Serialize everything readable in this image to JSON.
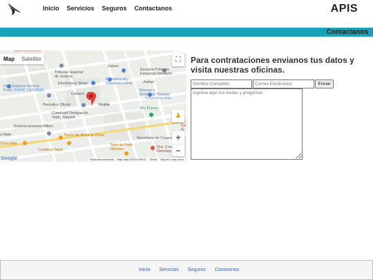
{
  "nav": {
    "links": [
      "Inicio",
      "Servicios",
      "Seguros",
      "Contactanos"
    ],
    "brand": "APIS"
  },
  "banner": {
    "title": "Contactanos"
  },
  "map": {
    "tabs": [
      "Map",
      "Satellite"
    ],
    "google": "Google",
    "footer": [
      "Keyboard shortcuts",
      "Map data ©2023 INEGI",
      "Terms",
      "Report a map error"
    ],
    "labels": {
      "tribunal": "Tribunal Superior\nde Justicia",
      "escuela": "Escuela Primaria\nFernando Montaño",
      "papeleria": "Papelería Ary\nStationery store",
      "juarez1": "Juárez",
      "juarez2": "Juárez",
      "dhl": "DHL Express Service\nPoint (TEPIC CENTRO)",
      "electronica": "Electronica Show",
      "canaco": "Canaco",
      "marcos": "Marcos y\nMolduras \"Batista\"",
      "picture": "Picture frame shop",
      "metlife": "Metlife",
      "periodico": "Periodico Oficial",
      "condusef": "Condusef Delegación\nTepic, Nayarit",
      "rivplanet": "Riv Planet",
      "estacionamiento": "Estacionamiento Milton",
      "nata": "a Nata",
      "tacos": "Tacos de Birria la China",
      "secretaria": "Secretaria de Finanzas",
      "chocolate": "Chocolate",
      "condesa": "Condesa Tepic",
      "todopollo": "Todo de Pollo\nChicken",
      "dra": "Dra. Con\nOdontop",
      "ce": "Ce\nN"
    }
  },
  "form": {
    "title": "Para contrataciones envianos tus datos y visita nuestras oficinas.",
    "name_placeholder": "Nombre Completo",
    "email_placeholder": "Correo Electronico",
    "submit": "Enviar",
    "message_placeholder": "Ingresa aqui tus dudas y preguntas"
  },
  "footer": {
    "links": [
      "Inicio",
      "Servicios",
      "Seguros",
      "Conocenos"
    ]
  },
  "colors": {
    "teal": "#17a2b8",
    "link": "#2f5fd0"
  },
  "icons": {
    "logo": "eagle-logo-icon",
    "fullscreen": "fullscreen-icon",
    "pegman": "pegman-icon",
    "pin": "map-pin-icon"
  }
}
